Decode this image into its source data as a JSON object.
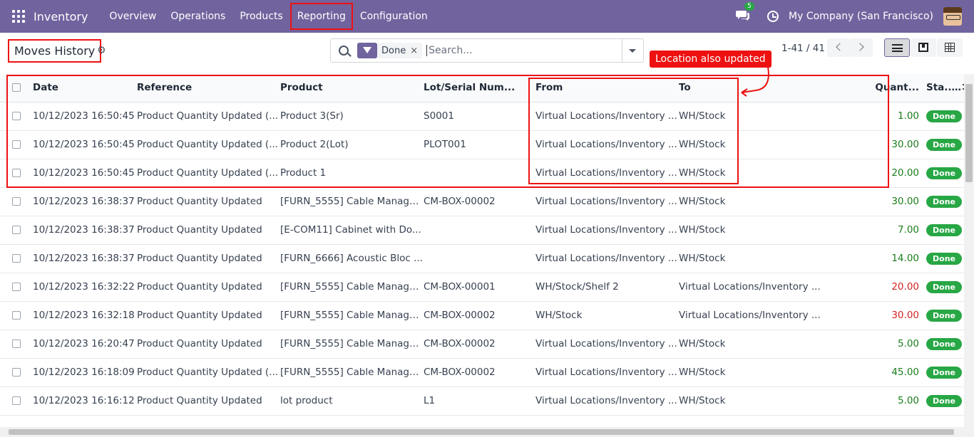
{
  "navbar": {
    "brand": "Inventory",
    "menu": [
      "Overview",
      "Operations",
      "Products",
      "Reporting",
      "Configuration"
    ],
    "chat_count": "5",
    "company": "My Company (San Francisco)"
  },
  "control": {
    "title": "Moves History",
    "facet_label": "Done",
    "facet_remove": "×",
    "search_placeholder": "Search...",
    "pager": "1-41 / 41"
  },
  "annotation": {
    "label": "Location also updated"
  },
  "table": {
    "headers": {
      "date": "Date",
      "reference": "Reference",
      "product": "Product",
      "lot": "Lot/Serial Num...",
      "from": "From",
      "to": "To",
      "quantity": "Quant...",
      "status": "Sta..."
    },
    "rows": [
      {
        "date": "10/12/2023 16:50:45",
        "reference": "Product Quantity Updated (...",
        "product": "Product 3(Sr)",
        "lot": "S0001",
        "from": "Virtual Locations/Inventory ...",
        "to": "WH/Stock",
        "quantity": "1.00",
        "sign": "pos",
        "status": "Done"
      },
      {
        "date": "10/12/2023 16:50:45",
        "reference": "Product Quantity Updated (...",
        "product": "Product 2(Lot)",
        "lot": "PLOT001",
        "from": "Virtual Locations/Inventory ...",
        "to": "WH/Stock",
        "quantity": "30.00",
        "sign": "pos",
        "status": "Done"
      },
      {
        "date": "10/12/2023 16:50:45",
        "reference": "Product Quantity Updated (...",
        "product": "Product 1",
        "lot": "",
        "from": "Virtual Locations/Inventory ...",
        "to": "WH/Stock",
        "quantity": "20.00",
        "sign": "pos",
        "status": "Done"
      },
      {
        "date": "10/12/2023 16:38:37",
        "reference": "Product Quantity Updated",
        "product": "[FURN_5555] Cable Manage...",
        "lot": "CM-BOX-00002",
        "from": "Virtual Locations/Inventory ...",
        "to": "WH/Stock",
        "quantity": "30.00",
        "sign": "pos",
        "status": "Done"
      },
      {
        "date": "10/12/2023 16:38:37",
        "reference": "Product Quantity Updated",
        "product": "[E-COM11] Cabinet with Do...",
        "lot": "",
        "from": "Virtual Locations/Inventory ...",
        "to": "WH/Stock",
        "quantity": "7.00",
        "sign": "pos",
        "status": "Done"
      },
      {
        "date": "10/12/2023 16:38:37",
        "reference": "Product Quantity Updated",
        "product": "[FURN_6666] Acoustic Bloc ...",
        "lot": "",
        "from": "Virtual Locations/Inventory ...",
        "to": "WH/Stock",
        "quantity": "14.00",
        "sign": "pos",
        "status": "Done"
      },
      {
        "date": "10/12/2023 16:32:22",
        "reference": "Product Quantity Updated",
        "product": "[FURN_5555] Cable Manage...",
        "lot": "CM-BOX-00001",
        "from": "WH/Stock/Shelf 2",
        "to": "Virtual Locations/Inventory ...",
        "quantity": "20.00",
        "sign": "neg",
        "status": "Done"
      },
      {
        "date": "10/12/2023 16:32:18",
        "reference": "Product Quantity Updated",
        "product": "[FURN_5555] Cable Manage...",
        "lot": "CM-BOX-00002",
        "from": "WH/Stock",
        "to": "Virtual Locations/Inventory ...",
        "quantity": "30.00",
        "sign": "neg",
        "status": "Done"
      },
      {
        "date": "10/12/2023 16:20:47",
        "reference": "Product Quantity Updated",
        "product": "[FURN_5555] Cable Manage...",
        "lot": "CM-BOX-00002",
        "from": "Virtual Locations/Inventory ...",
        "to": "WH/Stock",
        "quantity": "5.00",
        "sign": "pos",
        "status": "Done"
      },
      {
        "date": "10/12/2023 16:18:09",
        "reference": "Product Quantity Updated (...",
        "product": "[FURN_5555] Cable Manage...",
        "lot": "CM-BOX-00002",
        "from": "Virtual Locations/Inventory ...",
        "to": "WH/Stock",
        "quantity": "45.00",
        "sign": "pos",
        "status": "Done"
      },
      {
        "date": "10/12/2023 16:16:12",
        "reference": "Product Quantity Updated",
        "product": "lot product",
        "lot": "L1",
        "from": "Virtual Locations/Inventory ...",
        "to": "WH/Stock",
        "quantity": "5.00",
        "sign": "pos",
        "status": "Done"
      }
    ]
  },
  "colors": {
    "navbar": "#71639e",
    "positive": "#1a7d1a",
    "negative": "#d32222",
    "badge": "#28a745",
    "annotation": "#e11111"
  }
}
